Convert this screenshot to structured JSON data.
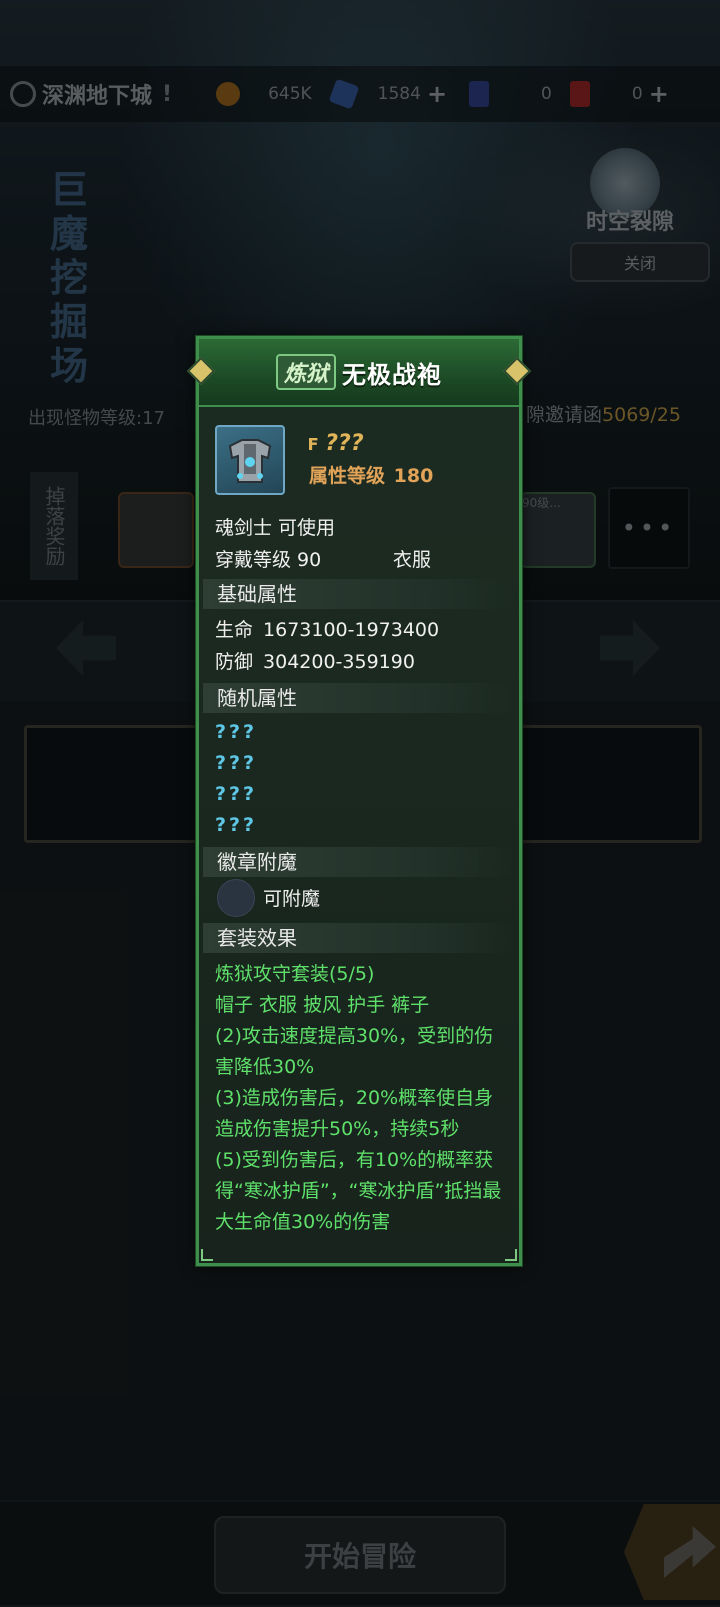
{
  "top_bar": {
    "location": "深渊地下城",
    "resources": [
      {
        "icon": "gold-coin-icon",
        "value": "645K",
        "plus": false
      },
      {
        "icon": "crystal-icon",
        "value": "1584",
        "plus": true
      },
      {
        "icon": "blue-ticket-icon",
        "value": "0",
        "plus": false
      },
      {
        "icon": "red-ticket-icon",
        "value": "0",
        "plus": true
      }
    ]
  },
  "side": {
    "rift_label": "时空裂隙",
    "close_label": "关闭"
  },
  "stage": {
    "vertical_title": "巨魔挖掘场",
    "monster_level": "出现怪物等级:17",
    "invite_prefix": "隙邀请函",
    "invite_count": "5069/25",
    "drop_label": "掉落奖励",
    "drop_slot_b_text": "90级...",
    "more_label": "•••"
  },
  "tooltip": {
    "set_tag": "炼狱",
    "item_name": "无极战袍",
    "rarity": "???",
    "attr_level_label": "属性等级",
    "attr_level_value": "180",
    "usable_by": "魂剑士 可使用",
    "wear_level": "穿戴等级 90",
    "slot_type": "衣服",
    "base_section": "基础属性",
    "base_stats": [
      {
        "name": "生命",
        "value": "1673100-1973400"
      },
      {
        "name": "防御",
        "value": "304200-359190"
      }
    ],
    "random_section": "随机属性",
    "random_stats": [
      "???",
      "???",
      "???",
      "???"
    ],
    "badge_section": "徽章附魔",
    "badge_text": "可附魔",
    "set_section": "套装效果",
    "set_name": "炼狱攻守套装(5/5)",
    "set_parts": "帽子 衣服 披风 护手 裤子",
    "set_effects": [
      "(2)攻击速度提高30%，受到的伤害降低30%",
      "(3)造成伤害后，20%概率使自身造成伤害提升50%，持续5秒",
      "(5)受到伤害后，有10%的概率获得“寒冰护盾”，“寒冰护盾”抵挡最大生命值30%的伤害"
    ]
  },
  "bottom": {
    "start_label": "开始冒险"
  },
  "colors": {
    "panel_border": "#3f8f4c",
    "set_text": "#5fe06a",
    "rarity": "#e0b458",
    "unknown_stat": "#5fc7e6"
  }
}
